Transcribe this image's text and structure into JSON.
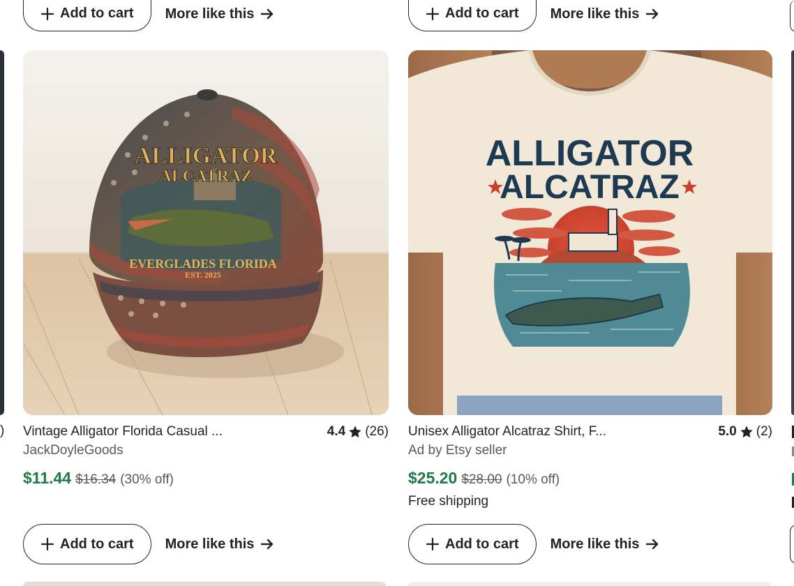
{
  "cards": [
    {
      "top_action": {
        "add_label": "Add to cart",
        "more_label": "More like this"
      },
      "image": {
        "hat_title": "ALLIGATOR",
        "hat_subtitle": "ALCATRAZ",
        "hat_footer": "EVERGLADES FLORIDA",
        "hat_est": "EST. 2025"
      },
      "title": "Vintage Alligator Florida Casual ...",
      "rating": "4.4",
      "reviews": "(26)",
      "seller": "JackDoyleGoods",
      "price": "$11.44",
      "original_price": "$16.34",
      "discount": "(30% off)",
      "bottom_action": {
        "add_label": "Add to cart",
        "more_label": "More like this"
      }
    },
    {
      "top_action": {
        "add_label": "Add to cart",
        "more_label": "More like this"
      },
      "image": {
        "shirt_title": "ALLIGATOR",
        "shirt_subtitle": "ALCATRAZ"
      },
      "title": "Unisex Alligator Alcatraz Shirt, F...",
      "rating": "5.0",
      "reviews": "(2)",
      "seller": "Ad by Etsy seller",
      "price": "$25.20",
      "original_price": "$28.00",
      "discount": "(10% off)",
      "shipping": "Free shipping",
      "bottom_action": {
        "add_label": "Add to cart",
        "more_label": "More like this"
      }
    }
  ],
  "colors": {
    "sale_price": "#1e7a46",
    "muted": "#595959",
    "text": "#222222"
  }
}
